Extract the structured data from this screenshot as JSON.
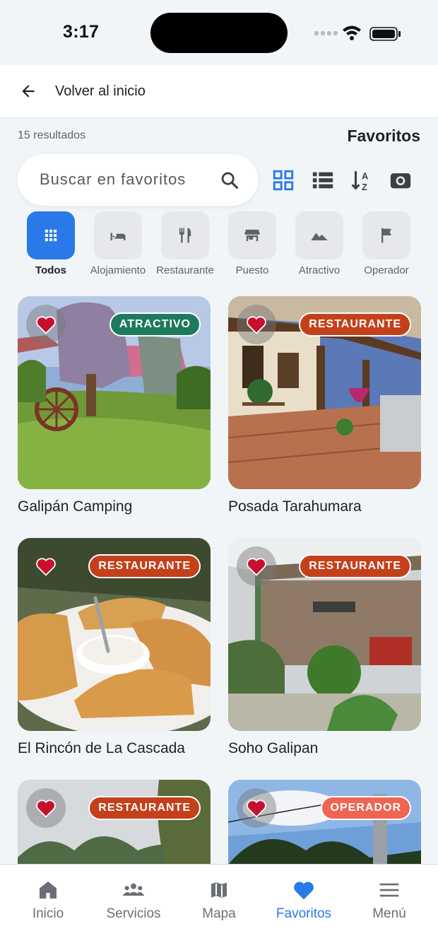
{
  "status": {
    "time": "3:17"
  },
  "header": {
    "back_label": "Volver al inicio"
  },
  "results": {
    "count_text": "15 resultados"
  },
  "page": {
    "title": "Favoritos"
  },
  "search": {
    "placeholder": "Buscar en favoritos",
    "value": ""
  },
  "view_controls": [
    {
      "icon": "grid-view-icon",
      "active": true
    },
    {
      "icon": "list-view-icon",
      "active": false
    },
    {
      "icon": "sort-icon",
      "active": false
    },
    {
      "icon": "photo-view-icon",
      "active": false
    }
  ],
  "categories": [
    {
      "label": "Todos",
      "icon": "grid-icon",
      "active": true
    },
    {
      "label": "Alojamiento",
      "icon": "bed-icon",
      "active": false
    },
    {
      "label": "Restaurante",
      "icon": "fork-knife-icon",
      "active": false
    },
    {
      "label": "Puesto",
      "icon": "store-icon",
      "active": false
    },
    {
      "label": "Atractivo",
      "icon": "mountain-icon",
      "active": false
    },
    {
      "label": "Operador",
      "icon": "flag-icon",
      "active": false
    }
  ],
  "favorites": [
    {
      "name": "Galipán Camping",
      "badge": "ATRACTIVO",
      "favorited": true
    },
    {
      "name": "Posada Tarahumara",
      "badge": "RESTAURANTE",
      "favorited": true
    },
    {
      "name": "El Rincón de La Cascada",
      "badge": "RESTAURANTE",
      "favorited": true
    },
    {
      "name": "Soho Galipan",
      "badge": "RESTAURANTE",
      "favorited": true
    },
    {
      "name": "",
      "badge": "RESTAURANTE",
      "favorited": true
    },
    {
      "name": "",
      "badge": "OPERADOR",
      "favorited": true
    }
  ],
  "bottom_nav": [
    {
      "label": "Inicio",
      "icon": "home-icon",
      "active": false
    },
    {
      "label": "Servicios",
      "icon": "people-icon",
      "active": false
    },
    {
      "label": "Mapa",
      "icon": "map-icon",
      "active": false
    },
    {
      "label": "Favoritos",
      "icon": "heart-icon",
      "active": true
    },
    {
      "label": "Menú",
      "icon": "menu-icon",
      "active": false
    }
  ],
  "colors": {
    "primary": "#2979e8",
    "heart": "#c8102e",
    "badge_atractivo": "#1e7a5c",
    "badge_restaurante": "#c4401b",
    "badge_operador": "#ef6553"
  }
}
